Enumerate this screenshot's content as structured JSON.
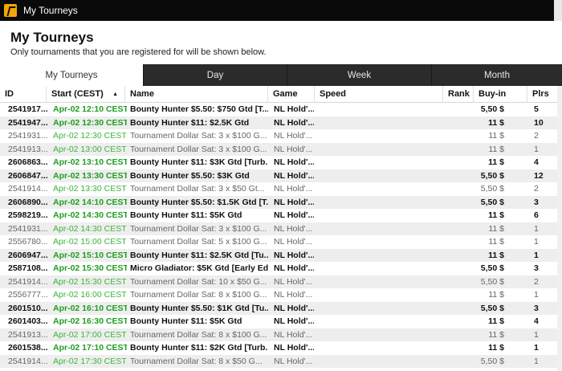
{
  "window": {
    "title": "My Tourneys"
  },
  "header": {
    "title": "My Tourneys",
    "subtitle": "Only tournaments that you are registered for will be shown below."
  },
  "tabs": [
    {
      "label": "My Tourneys",
      "active": true
    },
    {
      "label": "Day",
      "active": false
    },
    {
      "label": "Week",
      "active": false
    },
    {
      "label": "Month",
      "active": false
    }
  ],
  "columns": {
    "id": "ID",
    "start": "Start (CEST)",
    "name": "Name",
    "game": "Game",
    "speed": "Speed",
    "rank": "Rank",
    "buyin": "Buy-in",
    "plrs": "Plrs"
  },
  "sort_indicator": "▲",
  "colors": {
    "accent_green": "#1e9e1e",
    "tab_bar": "#2b2b2b",
    "titlebar": "#0a0a0a",
    "logo": "#f2a800"
  },
  "rows": [
    {
      "id": "2541917...",
      "start": "Apr-02 12:10 CEST",
      "name": "Bounty Hunter $5.50: $750 Gtd [T...",
      "game": "NL Hold'...",
      "buyin": "5,50 $",
      "plrs": "5",
      "bold": true
    },
    {
      "id": "2541947...",
      "start": "Apr-02 12:30 CEST",
      "name": "Bounty Hunter $11: $2.5K Gtd",
      "game": "NL Hold'...",
      "buyin": "11 $",
      "plrs": "10",
      "bold": true
    },
    {
      "id": "2541931...",
      "start": "Apr-02 12:30 CEST",
      "name": "Tournament Dollar Sat: 3 x $100 G...",
      "game": "NL Hold'...",
      "buyin": "11 $",
      "plrs": "2",
      "bold": false
    },
    {
      "id": "2541913...",
      "start": "Apr-02 13:00 CEST",
      "name": "Tournament Dollar Sat: 3 x $100 G...",
      "game": "NL Hold'...",
      "buyin": "11 $",
      "plrs": "1",
      "bold": false
    },
    {
      "id": "2606863...",
      "start": "Apr-02 13:10 CEST",
      "name": "Bounty Hunter $11: $3K Gtd [Turb...",
      "game": "NL Hold'...",
      "buyin": "11 $",
      "plrs": "4",
      "bold": true
    },
    {
      "id": "2606847...",
      "start": "Apr-02 13:30 CEST",
      "name": "Bounty Hunter $5.50: $3K Gtd",
      "game": "NL Hold'...",
      "buyin": "5,50 $",
      "plrs": "12",
      "bold": true
    },
    {
      "id": "2541914...",
      "start": "Apr-02 13:30 CEST",
      "name": "Tournament Dollar Sat: 3 x $50 Gt...",
      "game": "NL Hold'...",
      "buyin": "5,50 $",
      "plrs": "2",
      "bold": false
    },
    {
      "id": "2606890...",
      "start": "Apr-02 14:10 CEST",
      "name": "Bounty Hunter $5.50: $1.5K Gtd [T...",
      "game": "NL Hold'...",
      "buyin": "5,50 $",
      "plrs": "3",
      "bold": true
    },
    {
      "id": "2598219...",
      "start": "Apr-02 14:30 CEST",
      "name": "Bounty Hunter $11: $5K Gtd",
      "game": "NL Hold'...",
      "buyin": "11 $",
      "plrs": "6",
      "bold": true
    },
    {
      "id": "2541931...",
      "start": "Apr-02 14:30 CEST",
      "name": "Tournament Dollar Sat: 3 x $100 G...",
      "game": "NL Hold'...",
      "buyin": "11 $",
      "plrs": "1",
      "bold": false
    },
    {
      "id": "2556780...",
      "start": "Apr-02 15:00 CEST",
      "name": "Tournament Dollar Sat: 5 x $100 G...",
      "game": "NL Hold'...",
      "buyin": "11 $",
      "plrs": "1",
      "bold": false
    },
    {
      "id": "2606947...",
      "start": "Apr-02 15:10 CEST",
      "name": "Bounty Hunter $11: $2.5K Gtd [Tu...",
      "game": "NL Hold'...",
      "buyin": "11 $",
      "plrs": "1",
      "bold": true
    },
    {
      "id": "2587108...",
      "start": "Apr-02 15:30 CEST",
      "name": "Micro Gladiator: $5K Gtd [Early Ed...",
      "game": "NL Hold'...",
      "buyin": "5,50 $",
      "plrs": "3",
      "bold": true
    },
    {
      "id": "2541914...",
      "start": "Apr-02 15:30 CEST",
      "name": "Tournament Dollar Sat: 10 x $50 G...",
      "game": "NL Hold'...",
      "buyin": "5,50 $",
      "plrs": "2",
      "bold": false
    },
    {
      "id": "2556777...",
      "start": "Apr-02 16:00 CEST",
      "name": "Tournament Dollar Sat: 8 x $100 G...",
      "game": "NL Hold'...",
      "buyin": "11 $",
      "plrs": "1",
      "bold": false
    },
    {
      "id": "2601510...",
      "start": "Apr-02 16:10 CEST",
      "name": "Bounty Hunter $5.50: $1K Gtd [Tu...",
      "game": "NL Hold'...",
      "buyin": "5,50 $",
      "plrs": "3",
      "bold": true
    },
    {
      "id": "2601403...",
      "start": "Apr-02 16:30 CEST",
      "name": "Bounty Hunter $11: $5K Gtd",
      "game": "NL Hold'...",
      "buyin": "11 $",
      "plrs": "4",
      "bold": true
    },
    {
      "id": "2541913...",
      "start": "Apr-02 17:00 CEST",
      "name": "Tournament Dollar Sat: 8 x $100 G...",
      "game": "NL Hold'...",
      "buyin": "11 $",
      "plrs": "1",
      "bold": false
    },
    {
      "id": "2601538...",
      "start": "Apr-02 17:10 CEST",
      "name": "Bounty Hunter $11: $2K Gtd [Turb...",
      "game": "NL Hold'...",
      "buyin": "11 $",
      "plrs": "1",
      "bold": true
    },
    {
      "id": "2541914...",
      "start": "Apr-02 17:30 CEST",
      "name": "Tournament Dollar Sat: 8 x $50 G...",
      "game": "NL Hold'...",
      "buyin": "5,50 $",
      "plrs": "1",
      "bold": false
    }
  ]
}
